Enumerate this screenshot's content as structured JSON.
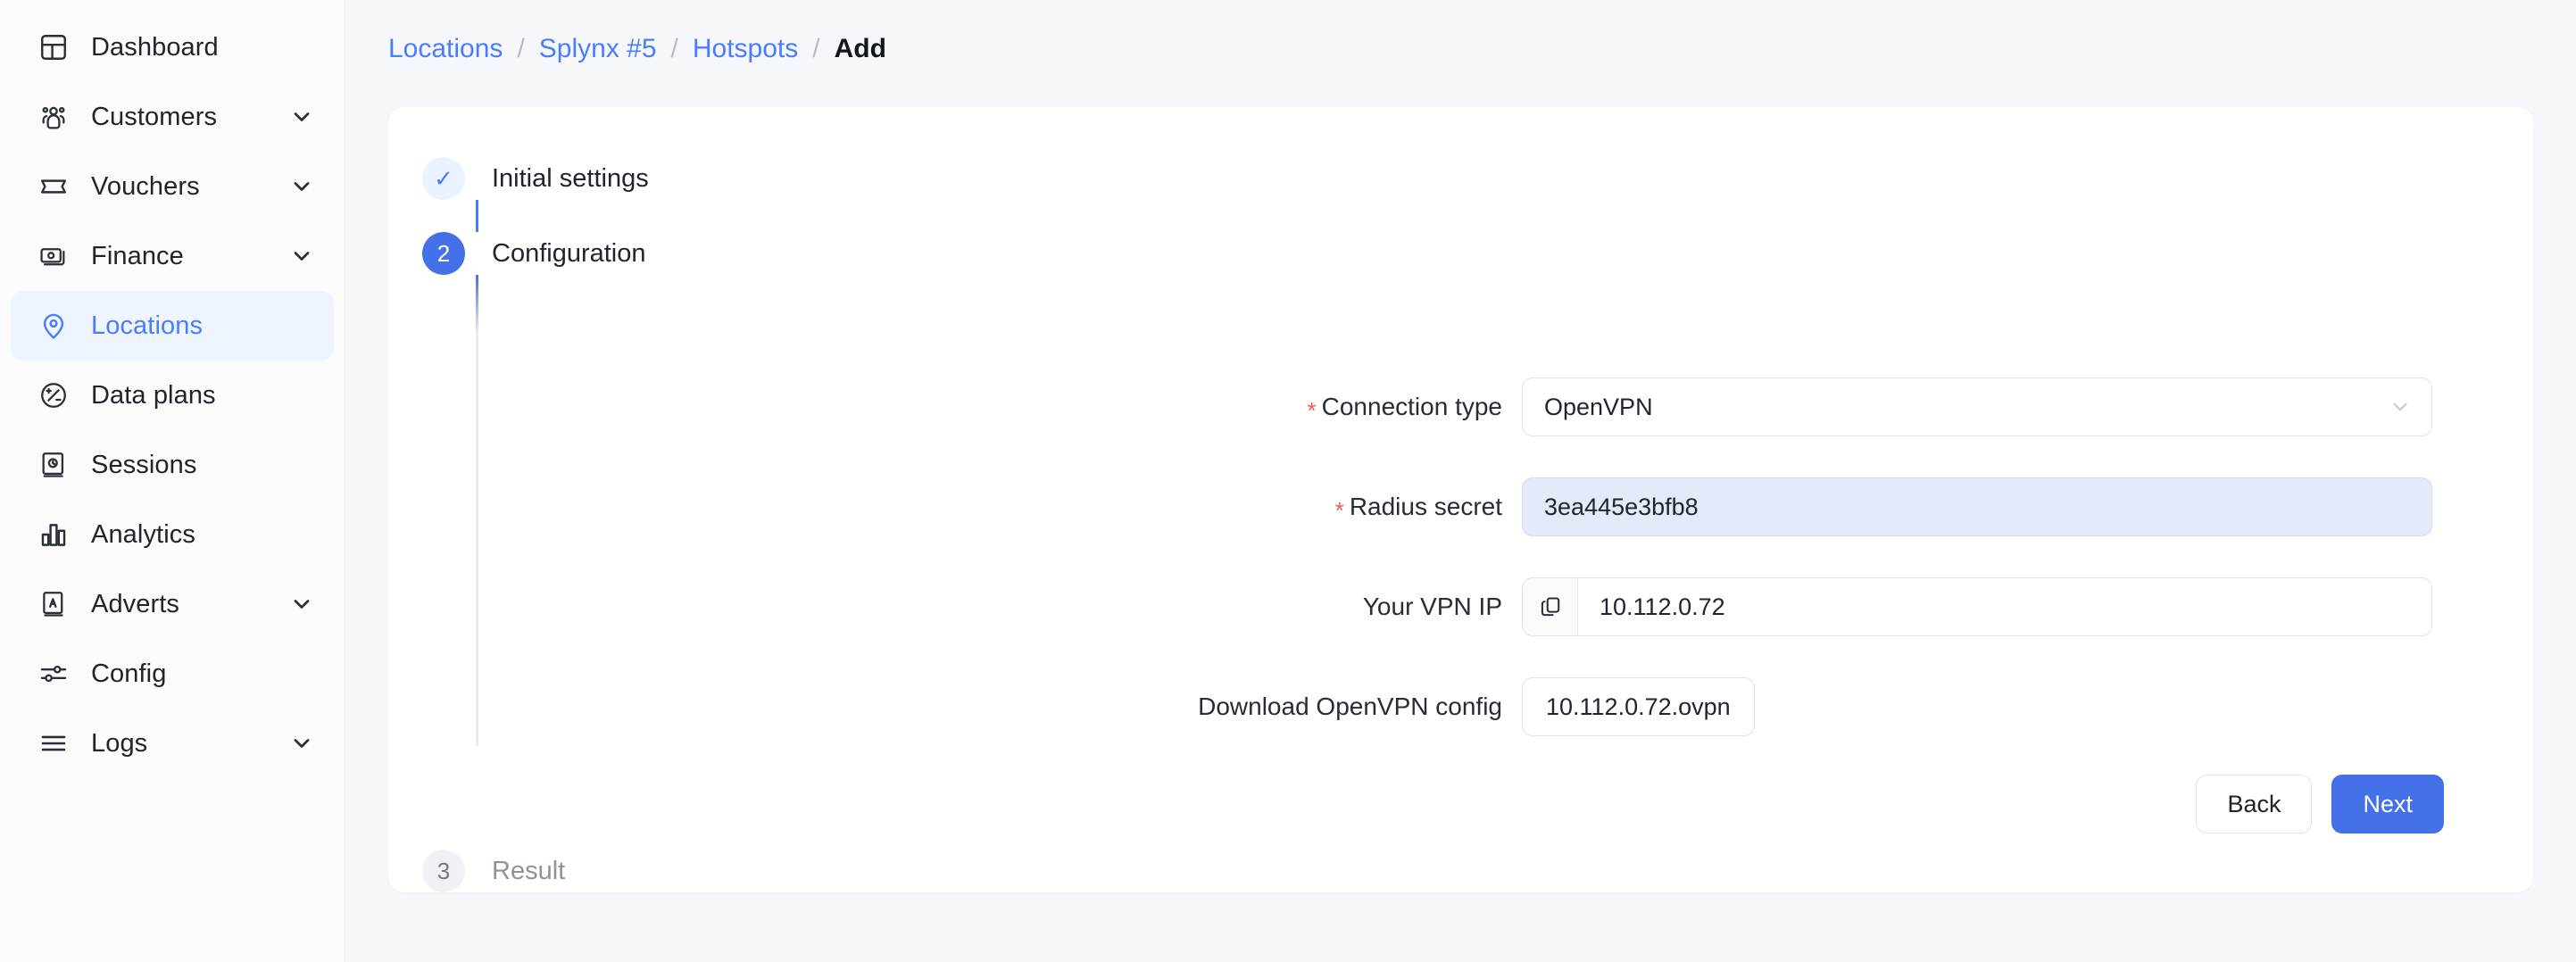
{
  "sidebar": {
    "items": [
      {
        "label": "Dashboard",
        "icon": "dashboard-icon",
        "expandable": false,
        "active": false
      },
      {
        "label": "Customers",
        "icon": "customers-icon",
        "expandable": true,
        "active": false
      },
      {
        "label": "Vouchers",
        "icon": "voucher-icon",
        "expandable": true,
        "active": false
      },
      {
        "label": "Finance",
        "icon": "money-icon",
        "expandable": true,
        "active": false
      },
      {
        "label": "Locations",
        "icon": "map-pin-icon",
        "expandable": false,
        "active": true
      },
      {
        "label": "Data plans",
        "icon": "data-plan-icon",
        "expandable": false,
        "active": false
      },
      {
        "label": "Sessions",
        "icon": "sessions-icon",
        "expandable": false,
        "active": false
      },
      {
        "label": "Analytics",
        "icon": "bar-chart-icon",
        "expandable": false,
        "active": false
      },
      {
        "label": "Adverts",
        "icon": "adverts-icon",
        "expandable": true,
        "active": false
      },
      {
        "label": "Config",
        "icon": "sliders-icon",
        "expandable": false,
        "active": false
      },
      {
        "label": "Logs",
        "icon": "logs-icon",
        "expandable": true,
        "active": false
      }
    ]
  },
  "breadcrumb": {
    "items": [
      "Locations",
      "Splynx #5",
      "Hotspots"
    ],
    "separator": "/",
    "current": "Add"
  },
  "stepper": {
    "steps": [
      {
        "marker": "✓",
        "label": "Initial settings",
        "state": "done"
      },
      {
        "marker": "2",
        "label": "Configuration",
        "state": "current"
      },
      {
        "marker": "3",
        "label": "Result",
        "state": "todo"
      }
    ]
  },
  "form": {
    "connection_type": {
      "label": "Connection type",
      "required": true,
      "value": "OpenVPN",
      "caret_icon": "chevron-down-icon"
    },
    "radius_secret": {
      "label": "Radius secret",
      "required": true,
      "value": "3ea445e3bfb8",
      "highlighted": true
    },
    "vpn_ip": {
      "label": "Your VPN IP",
      "required": false,
      "value": "10.112.0.72",
      "addon_icon": "copy-icon"
    },
    "download_config": {
      "label": "Download OpenVPN config",
      "required": false,
      "file_name": "10.112.0.72.ovpn"
    }
  },
  "actions": {
    "back_label": "Back",
    "next_label": "Next"
  },
  "colors": {
    "accent": "#4470e8",
    "link": "#4a7dfc",
    "required_star": "#f05a5a",
    "page_bg": "#f5f7fb",
    "card_bg": "#ffffff",
    "active_nav_bg": "#eff5ff",
    "highlight_field_bg": "#e4eaf9"
  }
}
